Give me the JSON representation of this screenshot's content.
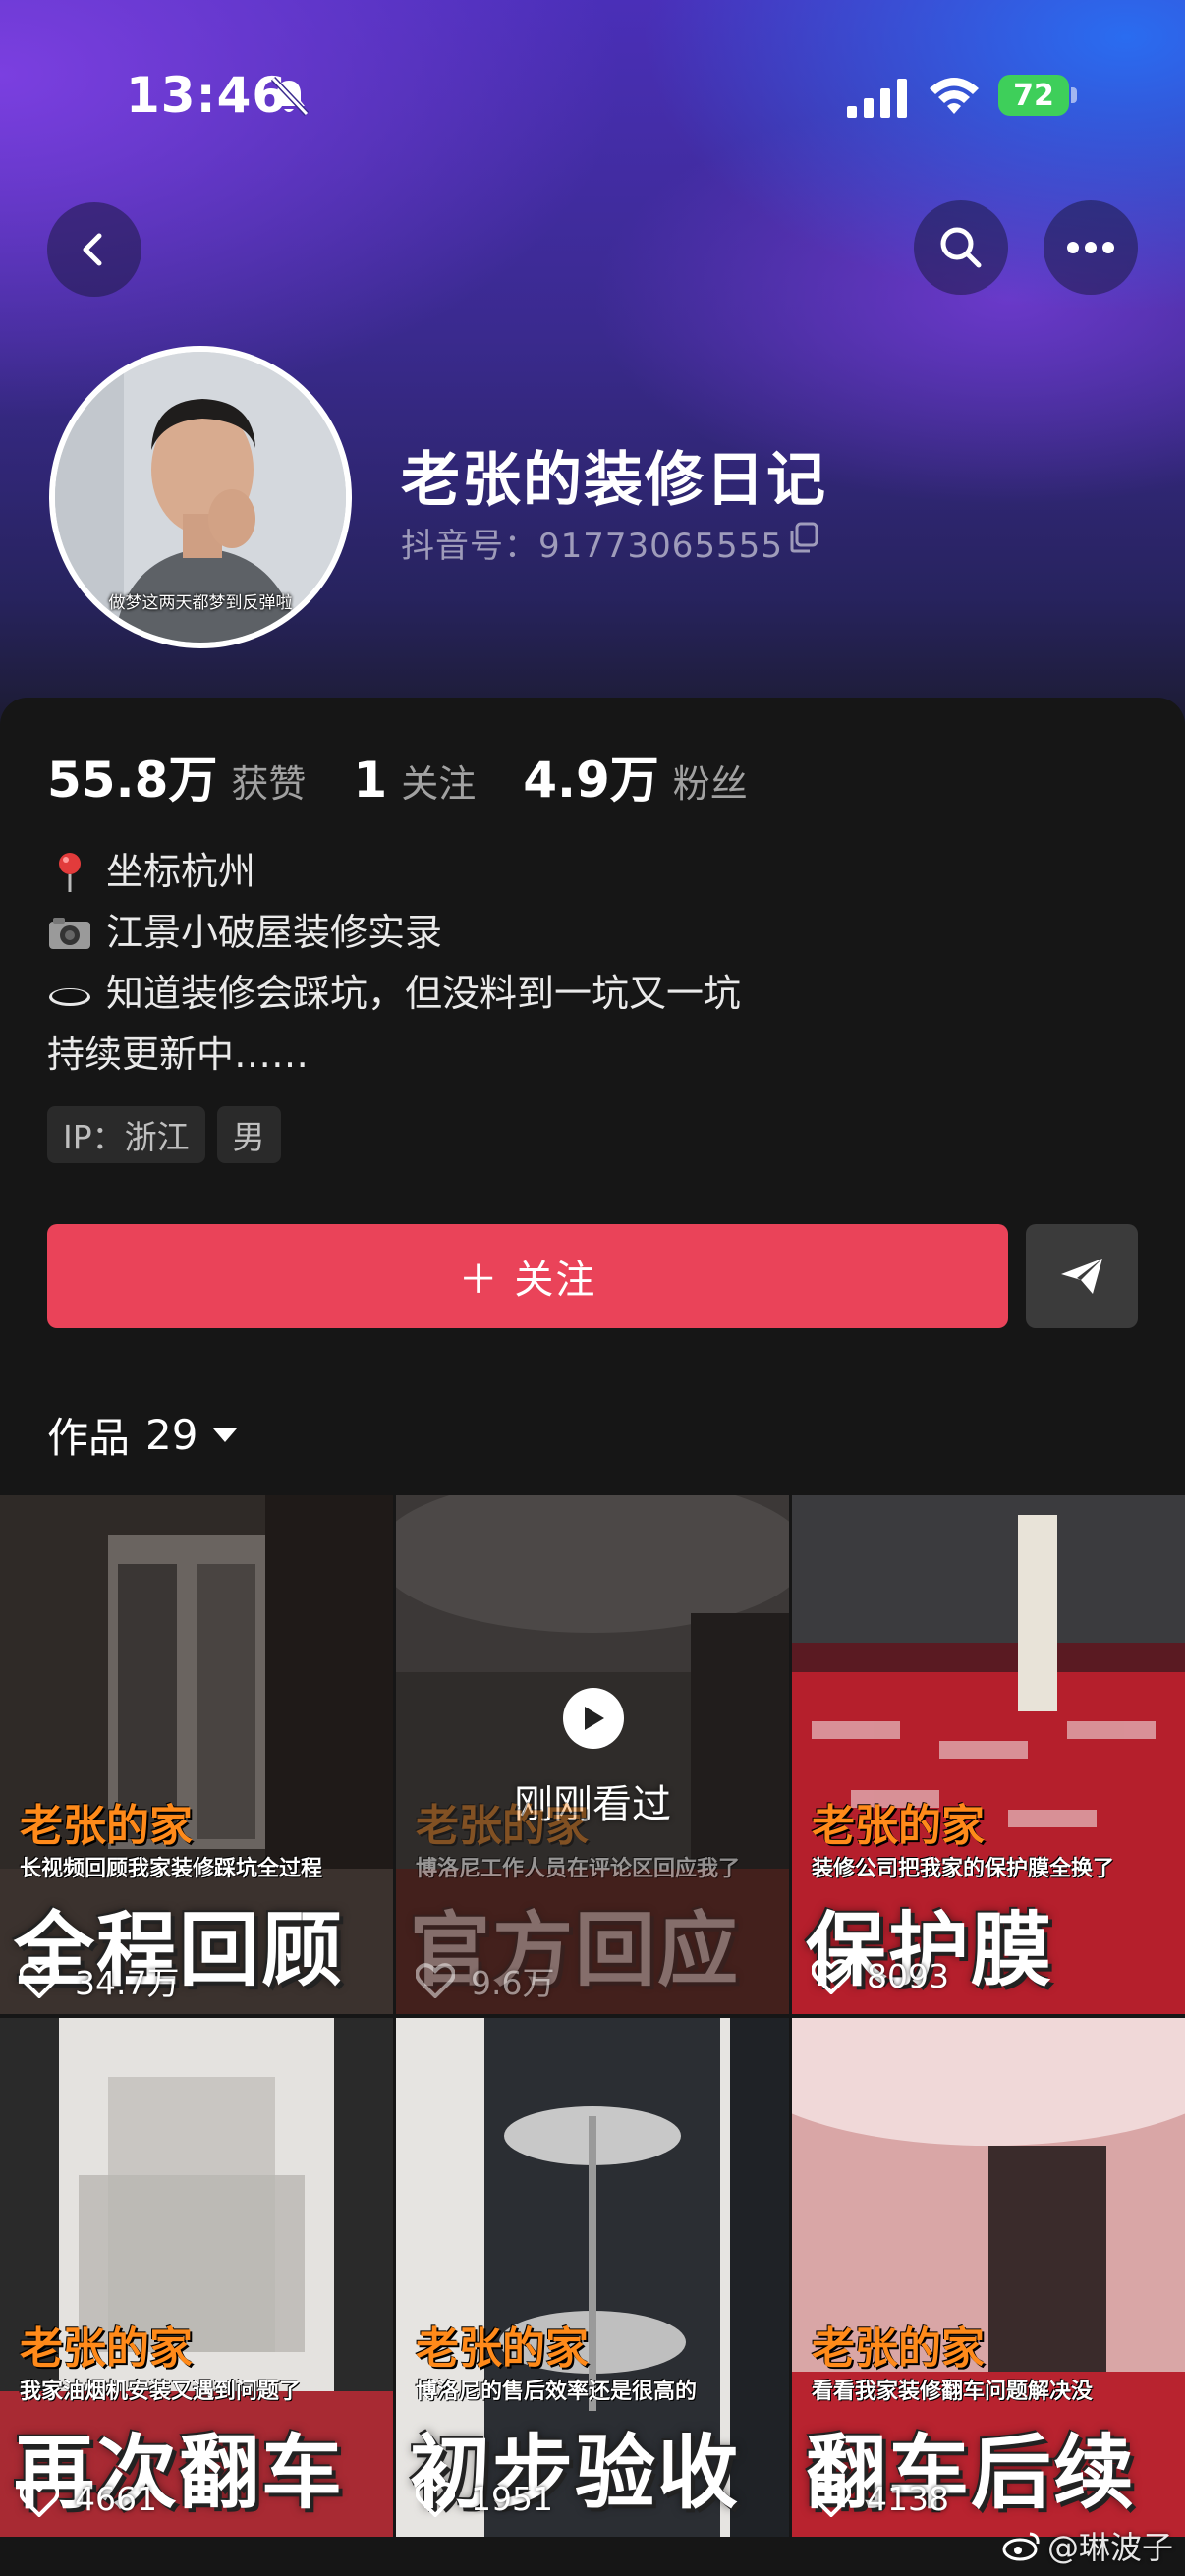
{
  "status_bar": {
    "time": "13:46",
    "battery": "72"
  },
  "profile": {
    "name": "老张的装修日记",
    "douyin_id": "抖音号：91773065555",
    "avatar_caption": "做梦这两天都梦到反弹啦"
  },
  "stats": [
    {
      "num": "55.8万",
      "label": "获赞"
    },
    {
      "num": "1",
      "label": "关注"
    },
    {
      "num": "4.9万",
      "label": "粉丝"
    }
  ],
  "bio": [
    {
      "icon": "pin-icon",
      "text": "坐标杭州"
    },
    {
      "icon": "camera-icon",
      "text": "江景小破屋装修实录"
    },
    {
      "icon": "hole-icon",
      "text": "知道装修会踩坑，但没料到一坑又一坑"
    },
    {
      "icon": "",
      "text": "持续更新中……"
    }
  ],
  "tags": [
    "IP：浙江",
    "男"
  ],
  "actions": {
    "follow_label": "＋ 关注"
  },
  "works": {
    "label": "作品",
    "count": "29"
  },
  "videos": [
    {
      "watermark": "老张的家",
      "subtitle": "长视频回顾我家装修踩坑全过程",
      "big": "全程回顾",
      "likes": "34.7万"
    },
    {
      "watermark": "老张的家",
      "subtitle": "博洛尼工作人员在评论区回应我了",
      "big": "官方回应",
      "likes": "9.6万",
      "recent": "刚刚看过"
    },
    {
      "watermark": "老张的家",
      "subtitle": "装修公司把我家的保护膜全换了",
      "big": "保护膜",
      "likes": "8093"
    },
    {
      "watermark": "老张的家",
      "subtitle": "我家油烟机安装又遇到问题了",
      "big": "再次翻车",
      "likes": "4661"
    },
    {
      "watermark": "老张的家",
      "subtitle": "博洛尼的售后效率还是很高的",
      "big": "初步验收",
      "likes": "1951"
    },
    {
      "watermark": "老张的家",
      "subtitle": "看看我家装修翻车问题解决没",
      "big": "翻车后续",
      "likes": "4138"
    }
  ],
  "weibo_watermark": "@琳波子",
  "colors": {
    "follow": "#ea4359",
    "watermark_orange": "#ff8a1a",
    "panel": "#161616"
  }
}
